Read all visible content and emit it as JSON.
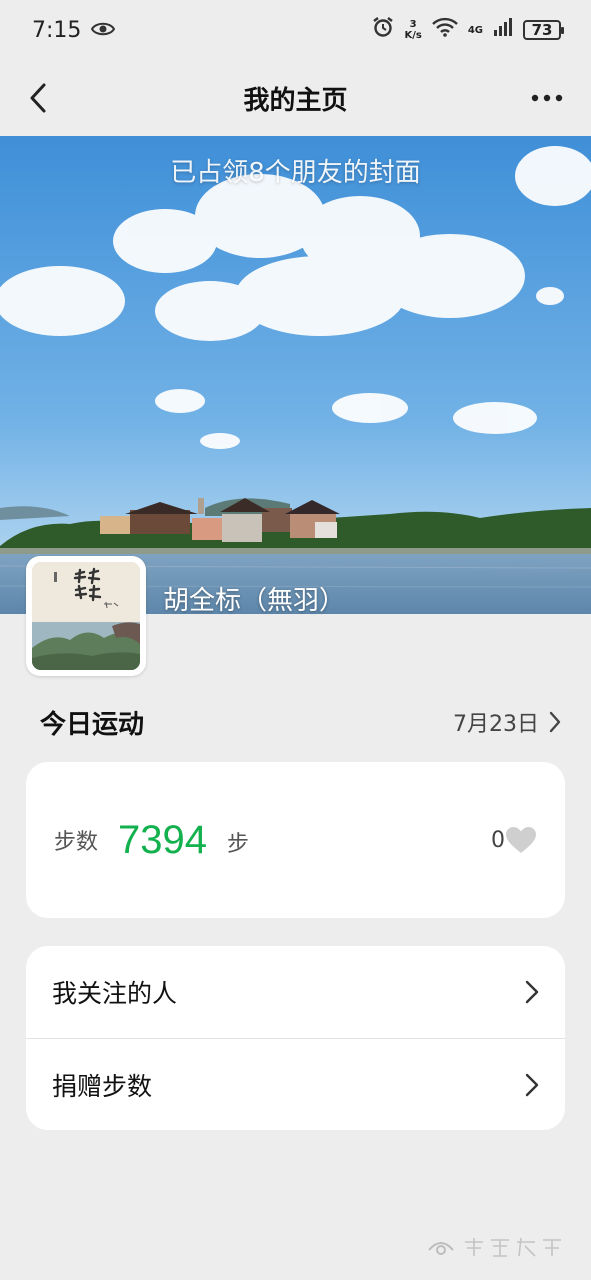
{
  "status_bar": {
    "time": "7:15",
    "net_speed_value": "3",
    "net_speed_unit": "K/s",
    "network_type": "4G",
    "battery": "73"
  },
  "nav": {
    "title": "我的主页"
  },
  "cover": {
    "caption": "已占领8个朋友的封面",
    "user_name": "胡全标（無羽）"
  },
  "today": {
    "title": "今日运动",
    "date": "7月23日"
  },
  "steps": {
    "label": "步数",
    "value": "7394",
    "unit": "步",
    "likes": "0"
  },
  "menu": {
    "items": [
      {
        "label": "我关注的人"
      },
      {
        "label": "捐赠步数"
      }
    ]
  },
  "colors": {
    "accent_green": "#12b14d",
    "background": "#ededed"
  }
}
